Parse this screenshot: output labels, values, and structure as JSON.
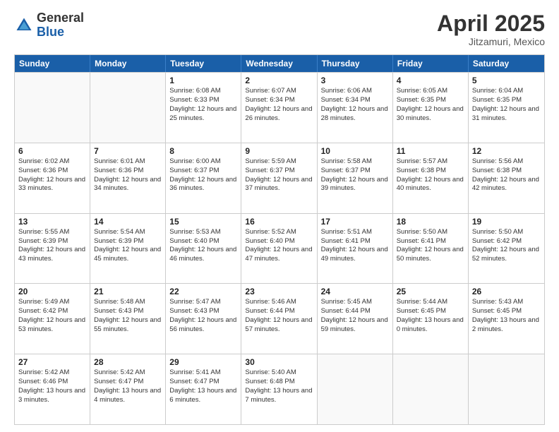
{
  "logo": {
    "general": "General",
    "blue": "Blue"
  },
  "title": {
    "month": "April 2025",
    "location": "Jitzamuri, Mexico"
  },
  "header_days": [
    "Sunday",
    "Monday",
    "Tuesday",
    "Wednesday",
    "Thursday",
    "Friday",
    "Saturday"
  ],
  "weeks": [
    [
      {
        "day": "",
        "sunrise": "",
        "sunset": "",
        "daylight": ""
      },
      {
        "day": "",
        "sunrise": "",
        "sunset": "",
        "daylight": ""
      },
      {
        "day": "1",
        "sunrise": "Sunrise: 6:08 AM",
        "sunset": "Sunset: 6:33 PM",
        "daylight": "Daylight: 12 hours and 25 minutes."
      },
      {
        "day": "2",
        "sunrise": "Sunrise: 6:07 AM",
        "sunset": "Sunset: 6:34 PM",
        "daylight": "Daylight: 12 hours and 26 minutes."
      },
      {
        "day": "3",
        "sunrise": "Sunrise: 6:06 AM",
        "sunset": "Sunset: 6:34 PM",
        "daylight": "Daylight: 12 hours and 28 minutes."
      },
      {
        "day": "4",
        "sunrise": "Sunrise: 6:05 AM",
        "sunset": "Sunset: 6:35 PM",
        "daylight": "Daylight: 12 hours and 30 minutes."
      },
      {
        "day": "5",
        "sunrise": "Sunrise: 6:04 AM",
        "sunset": "Sunset: 6:35 PM",
        "daylight": "Daylight: 12 hours and 31 minutes."
      }
    ],
    [
      {
        "day": "6",
        "sunrise": "Sunrise: 6:02 AM",
        "sunset": "Sunset: 6:36 PM",
        "daylight": "Daylight: 12 hours and 33 minutes."
      },
      {
        "day": "7",
        "sunrise": "Sunrise: 6:01 AM",
        "sunset": "Sunset: 6:36 PM",
        "daylight": "Daylight: 12 hours and 34 minutes."
      },
      {
        "day": "8",
        "sunrise": "Sunrise: 6:00 AM",
        "sunset": "Sunset: 6:37 PM",
        "daylight": "Daylight: 12 hours and 36 minutes."
      },
      {
        "day": "9",
        "sunrise": "Sunrise: 5:59 AM",
        "sunset": "Sunset: 6:37 PM",
        "daylight": "Daylight: 12 hours and 37 minutes."
      },
      {
        "day": "10",
        "sunrise": "Sunrise: 5:58 AM",
        "sunset": "Sunset: 6:37 PM",
        "daylight": "Daylight: 12 hours and 39 minutes."
      },
      {
        "day": "11",
        "sunrise": "Sunrise: 5:57 AM",
        "sunset": "Sunset: 6:38 PM",
        "daylight": "Daylight: 12 hours and 40 minutes."
      },
      {
        "day": "12",
        "sunrise": "Sunrise: 5:56 AM",
        "sunset": "Sunset: 6:38 PM",
        "daylight": "Daylight: 12 hours and 42 minutes."
      }
    ],
    [
      {
        "day": "13",
        "sunrise": "Sunrise: 5:55 AM",
        "sunset": "Sunset: 6:39 PM",
        "daylight": "Daylight: 12 hours and 43 minutes."
      },
      {
        "day": "14",
        "sunrise": "Sunrise: 5:54 AM",
        "sunset": "Sunset: 6:39 PM",
        "daylight": "Daylight: 12 hours and 45 minutes."
      },
      {
        "day": "15",
        "sunrise": "Sunrise: 5:53 AM",
        "sunset": "Sunset: 6:40 PM",
        "daylight": "Daylight: 12 hours and 46 minutes."
      },
      {
        "day": "16",
        "sunrise": "Sunrise: 5:52 AM",
        "sunset": "Sunset: 6:40 PM",
        "daylight": "Daylight: 12 hours and 47 minutes."
      },
      {
        "day": "17",
        "sunrise": "Sunrise: 5:51 AM",
        "sunset": "Sunset: 6:41 PM",
        "daylight": "Daylight: 12 hours and 49 minutes."
      },
      {
        "day": "18",
        "sunrise": "Sunrise: 5:50 AM",
        "sunset": "Sunset: 6:41 PM",
        "daylight": "Daylight: 12 hours and 50 minutes."
      },
      {
        "day": "19",
        "sunrise": "Sunrise: 5:50 AM",
        "sunset": "Sunset: 6:42 PM",
        "daylight": "Daylight: 12 hours and 52 minutes."
      }
    ],
    [
      {
        "day": "20",
        "sunrise": "Sunrise: 5:49 AM",
        "sunset": "Sunset: 6:42 PM",
        "daylight": "Daylight: 12 hours and 53 minutes."
      },
      {
        "day": "21",
        "sunrise": "Sunrise: 5:48 AM",
        "sunset": "Sunset: 6:43 PM",
        "daylight": "Daylight: 12 hours and 55 minutes."
      },
      {
        "day": "22",
        "sunrise": "Sunrise: 5:47 AM",
        "sunset": "Sunset: 6:43 PM",
        "daylight": "Daylight: 12 hours and 56 minutes."
      },
      {
        "day": "23",
        "sunrise": "Sunrise: 5:46 AM",
        "sunset": "Sunset: 6:44 PM",
        "daylight": "Daylight: 12 hours and 57 minutes."
      },
      {
        "day": "24",
        "sunrise": "Sunrise: 5:45 AM",
        "sunset": "Sunset: 6:44 PM",
        "daylight": "Daylight: 12 hours and 59 minutes."
      },
      {
        "day": "25",
        "sunrise": "Sunrise: 5:44 AM",
        "sunset": "Sunset: 6:45 PM",
        "daylight": "Daylight: 13 hours and 0 minutes."
      },
      {
        "day": "26",
        "sunrise": "Sunrise: 5:43 AM",
        "sunset": "Sunset: 6:45 PM",
        "daylight": "Daylight: 13 hours and 2 minutes."
      }
    ],
    [
      {
        "day": "27",
        "sunrise": "Sunrise: 5:42 AM",
        "sunset": "Sunset: 6:46 PM",
        "daylight": "Daylight: 13 hours and 3 minutes."
      },
      {
        "day": "28",
        "sunrise": "Sunrise: 5:42 AM",
        "sunset": "Sunset: 6:47 PM",
        "daylight": "Daylight: 13 hours and 4 minutes."
      },
      {
        "day": "29",
        "sunrise": "Sunrise: 5:41 AM",
        "sunset": "Sunset: 6:47 PM",
        "daylight": "Daylight: 13 hours and 6 minutes."
      },
      {
        "day": "30",
        "sunrise": "Sunrise: 5:40 AM",
        "sunset": "Sunset: 6:48 PM",
        "daylight": "Daylight: 13 hours and 7 minutes."
      },
      {
        "day": "",
        "sunrise": "",
        "sunset": "",
        "daylight": ""
      },
      {
        "day": "",
        "sunrise": "",
        "sunset": "",
        "daylight": ""
      },
      {
        "day": "",
        "sunrise": "",
        "sunset": "",
        "daylight": ""
      }
    ]
  ]
}
